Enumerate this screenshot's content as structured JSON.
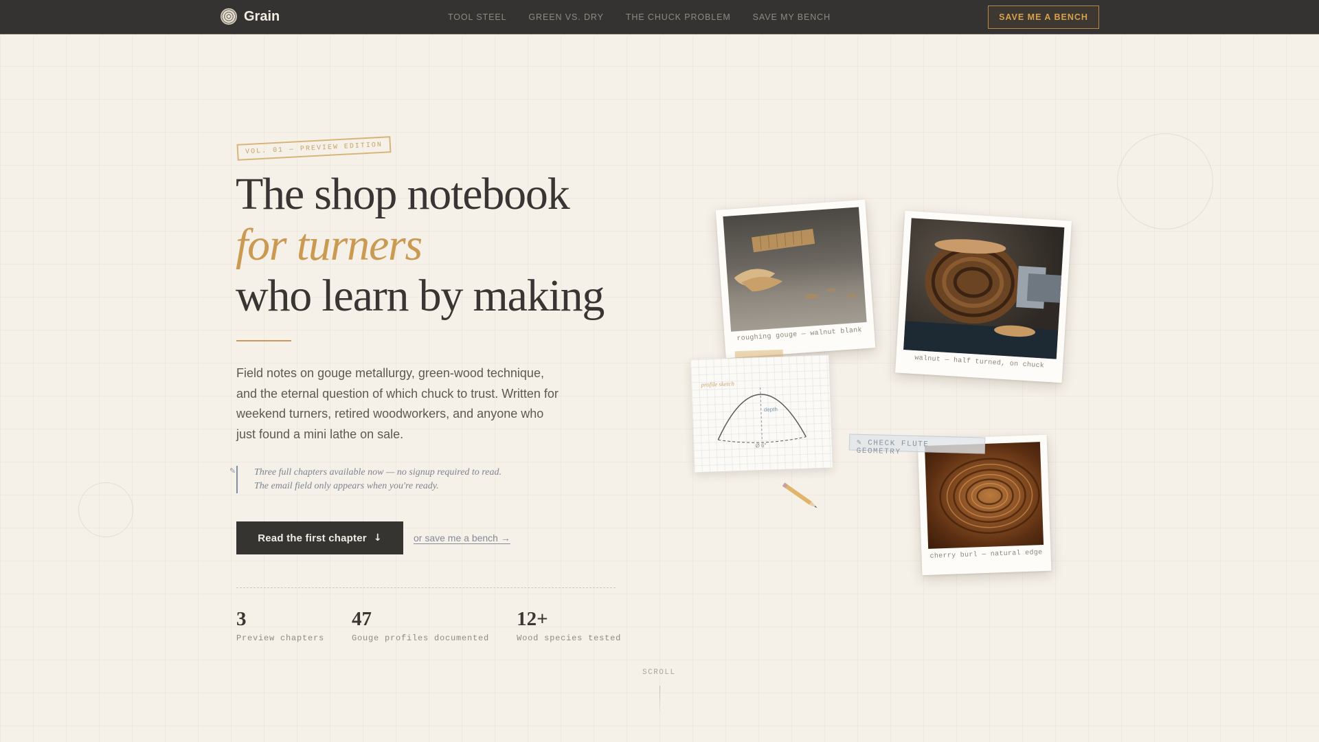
{
  "nav": {
    "brand": "Grain",
    "links": [
      "TOOL STEEL",
      "GREEN VS. DRY",
      "THE CHUCK PROBLEM",
      "SAVE MY BENCH"
    ],
    "cta": "SAVE ME A BENCH"
  },
  "hero": {
    "edition_tag": "VOL. 01 — PREVIEW EDITION",
    "headline_line1": "The shop notebook",
    "headline_accent": "for turners",
    "headline_line3": "who learn by making",
    "lede": "Field notes on gouge metallurgy, green-wood technique, and the eternal question of which chuck to trust. Written for weekend turners, retired woodworkers, and anyone who just found a mini lathe on sale.",
    "note": "Three full chapters available now — no signup required to read. The email field only appears when you're ready.",
    "primary_button": "Read the first chapter",
    "secondary_link": "or save me a bench →",
    "stats": [
      {
        "value": "3",
        "label": "Preview chapters"
      },
      {
        "value": "47",
        "label": "Gouge profiles documented"
      },
      {
        "value": "12+",
        "label": "Wood species tested"
      }
    ],
    "scroll_label": "SCROLL"
  },
  "gallery": {
    "photo1_caption": "roughing gouge — walnut blank",
    "photo2_caption": "walnut — half turned, on chuck",
    "photo3_caption": "cherry burl — natural edge",
    "sketch_label": "profile sketch",
    "sketch_depth": "depth",
    "sketch_diameter": "Ø 6\"",
    "sticky_note": "✎ CHECK FLUTE GEOMETRY"
  },
  "colors": {
    "nav_bg": "#353331",
    "page_bg": "#f5f0e8",
    "accent": "#cb9a52",
    "button_bg": "#363431"
  },
  "icons": {
    "brand": "wood-grain-logo-icon",
    "button_arrow": "arrow-down-icon",
    "note_marker": "pencil-icon"
  }
}
